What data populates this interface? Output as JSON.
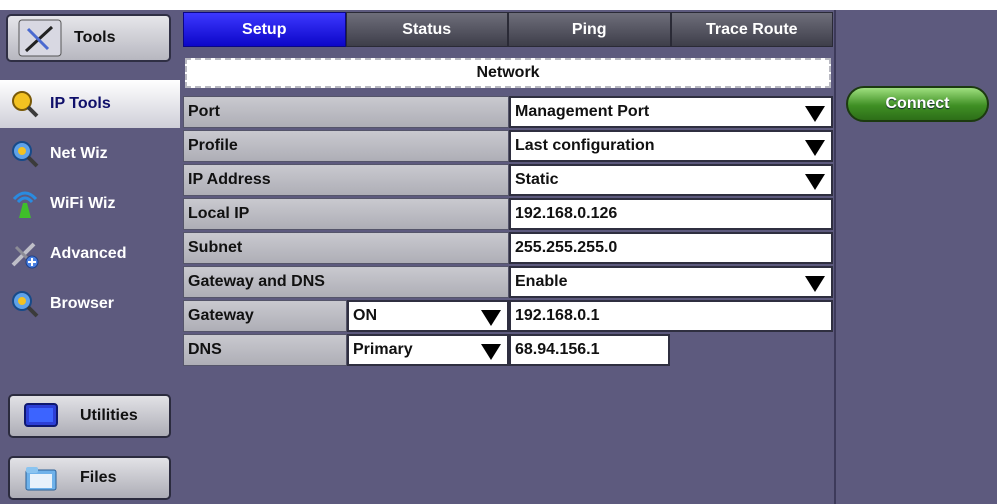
{
  "sidebar": {
    "tools_label": "Tools",
    "items": [
      {
        "label": "IP Tools",
        "icon": "magnifier-icon",
        "active": true
      },
      {
        "label": "Net Wiz",
        "icon": "magnifier-icon",
        "active": false
      },
      {
        "label": "WiFi Wiz",
        "icon": "wifi-antenna-icon",
        "active": false
      },
      {
        "label": "Advanced",
        "icon": "advanced-tools-icon",
        "active": false
      },
      {
        "label": "Browser",
        "icon": "magnifier-icon",
        "active": false
      }
    ],
    "utilities_label": "Utilities",
    "files_label": "Files"
  },
  "tabs": [
    {
      "label": "Setup",
      "active": true
    },
    {
      "label": "Status",
      "active": false
    },
    {
      "label": "Ping",
      "active": false
    },
    {
      "label": "Trace Route",
      "active": false
    }
  ],
  "section_title": "Network",
  "fields": {
    "port": {
      "label": "Port",
      "value": "Management Port"
    },
    "profile": {
      "label": "Profile",
      "value": "Last configuration"
    },
    "ip_address": {
      "label": "IP Address",
      "value": "Static"
    },
    "local_ip": {
      "label": "Local IP",
      "value": "192.168.0.126"
    },
    "subnet": {
      "label": "Subnet",
      "value": "255.255.255.0"
    },
    "gateway_dns": {
      "label": "Gateway and DNS",
      "value": "Enable"
    },
    "gateway": {
      "label": "Gateway",
      "mode": "ON",
      "value": "192.168.0.1"
    },
    "dns": {
      "label": "DNS",
      "mode": "Primary",
      "value": "68.94.156.1"
    }
  },
  "connect_label": "Connect",
  "colors": {
    "background": "#5d5a7e",
    "active_tab": "#1a14e6",
    "connect_button": "#3f8f24"
  }
}
